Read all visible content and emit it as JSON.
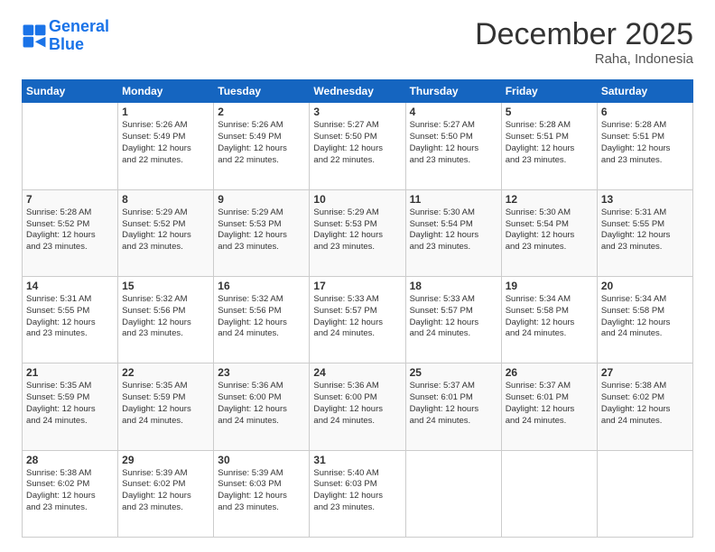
{
  "header": {
    "logo_line1": "General",
    "logo_line2": "Blue",
    "month": "December 2025",
    "location": "Raha, Indonesia"
  },
  "days_of_week": [
    "Sunday",
    "Monday",
    "Tuesday",
    "Wednesday",
    "Thursday",
    "Friday",
    "Saturday"
  ],
  "weeks": [
    [
      {
        "day": "",
        "text": ""
      },
      {
        "day": "1",
        "text": "Sunrise: 5:26 AM\nSunset: 5:49 PM\nDaylight: 12 hours\nand 22 minutes."
      },
      {
        "day": "2",
        "text": "Sunrise: 5:26 AM\nSunset: 5:49 PM\nDaylight: 12 hours\nand 22 minutes."
      },
      {
        "day": "3",
        "text": "Sunrise: 5:27 AM\nSunset: 5:50 PM\nDaylight: 12 hours\nand 22 minutes."
      },
      {
        "day": "4",
        "text": "Sunrise: 5:27 AM\nSunset: 5:50 PM\nDaylight: 12 hours\nand 23 minutes."
      },
      {
        "day": "5",
        "text": "Sunrise: 5:28 AM\nSunset: 5:51 PM\nDaylight: 12 hours\nand 23 minutes."
      },
      {
        "day": "6",
        "text": "Sunrise: 5:28 AM\nSunset: 5:51 PM\nDaylight: 12 hours\nand 23 minutes."
      }
    ],
    [
      {
        "day": "7",
        "text": "Sunrise: 5:28 AM\nSunset: 5:52 PM\nDaylight: 12 hours\nand 23 minutes."
      },
      {
        "day": "8",
        "text": "Sunrise: 5:29 AM\nSunset: 5:52 PM\nDaylight: 12 hours\nand 23 minutes."
      },
      {
        "day": "9",
        "text": "Sunrise: 5:29 AM\nSunset: 5:53 PM\nDaylight: 12 hours\nand 23 minutes."
      },
      {
        "day": "10",
        "text": "Sunrise: 5:29 AM\nSunset: 5:53 PM\nDaylight: 12 hours\nand 23 minutes."
      },
      {
        "day": "11",
        "text": "Sunrise: 5:30 AM\nSunset: 5:54 PM\nDaylight: 12 hours\nand 23 minutes."
      },
      {
        "day": "12",
        "text": "Sunrise: 5:30 AM\nSunset: 5:54 PM\nDaylight: 12 hours\nand 23 minutes."
      },
      {
        "day": "13",
        "text": "Sunrise: 5:31 AM\nSunset: 5:55 PM\nDaylight: 12 hours\nand 23 minutes."
      }
    ],
    [
      {
        "day": "14",
        "text": "Sunrise: 5:31 AM\nSunset: 5:55 PM\nDaylight: 12 hours\nand 23 minutes."
      },
      {
        "day": "15",
        "text": "Sunrise: 5:32 AM\nSunset: 5:56 PM\nDaylight: 12 hours\nand 23 minutes."
      },
      {
        "day": "16",
        "text": "Sunrise: 5:32 AM\nSunset: 5:56 PM\nDaylight: 12 hours\nand 24 minutes."
      },
      {
        "day": "17",
        "text": "Sunrise: 5:33 AM\nSunset: 5:57 PM\nDaylight: 12 hours\nand 24 minutes."
      },
      {
        "day": "18",
        "text": "Sunrise: 5:33 AM\nSunset: 5:57 PM\nDaylight: 12 hours\nand 24 minutes."
      },
      {
        "day": "19",
        "text": "Sunrise: 5:34 AM\nSunset: 5:58 PM\nDaylight: 12 hours\nand 24 minutes."
      },
      {
        "day": "20",
        "text": "Sunrise: 5:34 AM\nSunset: 5:58 PM\nDaylight: 12 hours\nand 24 minutes."
      }
    ],
    [
      {
        "day": "21",
        "text": "Sunrise: 5:35 AM\nSunset: 5:59 PM\nDaylight: 12 hours\nand 24 minutes."
      },
      {
        "day": "22",
        "text": "Sunrise: 5:35 AM\nSunset: 5:59 PM\nDaylight: 12 hours\nand 24 minutes."
      },
      {
        "day": "23",
        "text": "Sunrise: 5:36 AM\nSunset: 6:00 PM\nDaylight: 12 hours\nand 24 minutes."
      },
      {
        "day": "24",
        "text": "Sunrise: 5:36 AM\nSunset: 6:00 PM\nDaylight: 12 hours\nand 24 minutes."
      },
      {
        "day": "25",
        "text": "Sunrise: 5:37 AM\nSunset: 6:01 PM\nDaylight: 12 hours\nand 24 minutes."
      },
      {
        "day": "26",
        "text": "Sunrise: 5:37 AM\nSunset: 6:01 PM\nDaylight: 12 hours\nand 24 minutes."
      },
      {
        "day": "27",
        "text": "Sunrise: 5:38 AM\nSunset: 6:02 PM\nDaylight: 12 hours\nand 24 minutes."
      }
    ],
    [
      {
        "day": "28",
        "text": "Sunrise: 5:38 AM\nSunset: 6:02 PM\nDaylight: 12 hours\nand 23 minutes."
      },
      {
        "day": "29",
        "text": "Sunrise: 5:39 AM\nSunset: 6:02 PM\nDaylight: 12 hours\nand 23 minutes."
      },
      {
        "day": "30",
        "text": "Sunrise: 5:39 AM\nSunset: 6:03 PM\nDaylight: 12 hours\nand 23 minutes."
      },
      {
        "day": "31",
        "text": "Sunrise: 5:40 AM\nSunset: 6:03 PM\nDaylight: 12 hours\nand 23 minutes."
      },
      {
        "day": "",
        "text": ""
      },
      {
        "day": "",
        "text": ""
      },
      {
        "day": "",
        "text": ""
      }
    ]
  ]
}
